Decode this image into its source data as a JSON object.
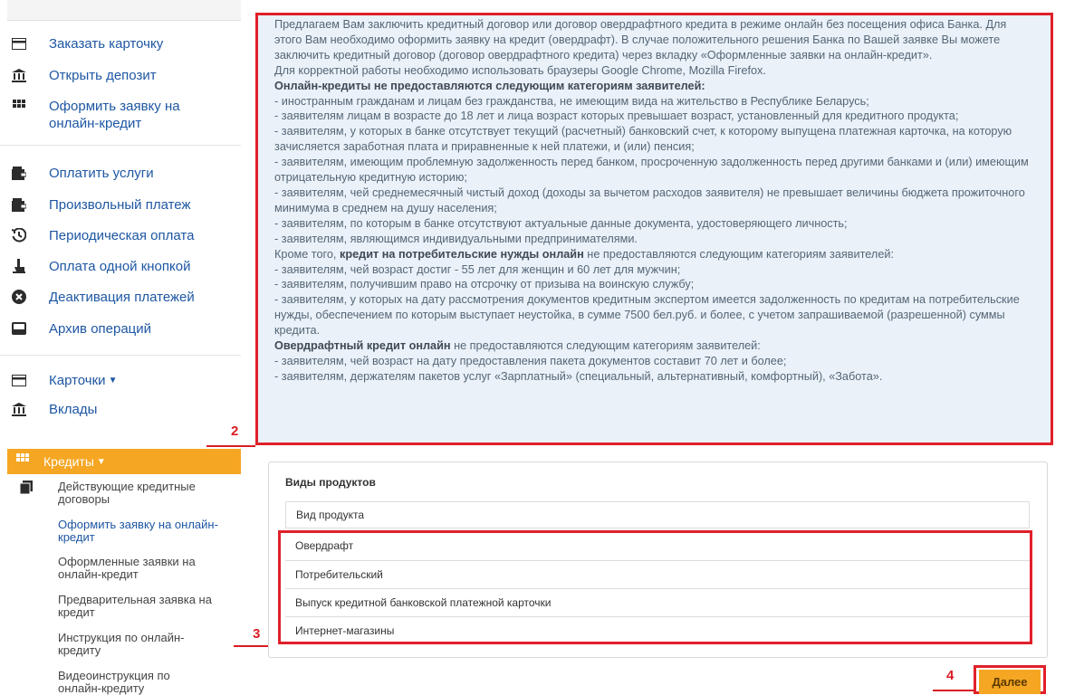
{
  "sidebar": {
    "items_top": [
      {
        "label": "Заказать карточку",
        "icon": "card-icon"
      },
      {
        "label": "Открыть депозит",
        "icon": "bank-icon"
      },
      {
        "label": "Оформить заявку на онлайн-кредит",
        "icon": "grid-icon"
      }
    ],
    "items_pay": [
      {
        "label": "Оплатить услуги",
        "icon": "wallet-icon"
      },
      {
        "label": "Произвольный платеж",
        "icon": "wallet-icon"
      },
      {
        "label": "Периодическая оплата",
        "icon": "history-icon"
      },
      {
        "label": "Оплата одной кнопкой",
        "icon": "hand-tap-icon"
      },
      {
        "label": "Деактивация платежей",
        "icon": "close-circle-icon"
      },
      {
        "label": "Архив операций",
        "icon": "archive-icon"
      }
    ],
    "items_acc": [
      {
        "label": "Карточки",
        "icon": "card-icon"
      },
      {
        "label": "Вклады",
        "icon": "bank-icon"
      }
    ],
    "credits_label": "Кредиты",
    "credits_sub": [
      {
        "label": "Действующие кредитные договоры"
      },
      {
        "label": "Оформить заявку на онлайн-кредит"
      },
      {
        "label": "Оформленные заявки на онлайн-кредит"
      },
      {
        "label": "Предварительная заявка на кредит"
      },
      {
        "label": "Инструкция по онлайн-кредиту"
      },
      {
        "label": "Видеоинструкция по онлайн-кредиту"
      }
    ]
  },
  "info": {
    "p1": "Предлагаем Вам заключить кредитный договор или договор овердрафтного кредита в режиме онлайн без посещения офиса Банка. Для этого Вам необходимо оформить заявку на кредит (овердрафт). В случае положительного решения Банка по Вашей заявке Вы можете заключить кредитный договор (договор овердрафтного кредита) через вкладку «Оформленные заявки на онлайн-кредит».",
    "p2": "Для корректной работы необходимо использовать браузеры Google Chrome, Mozilla Firefox.",
    "h1": "Онлайн-кредиты не предоставляются следующим категориям заявителей:",
    "list1": [
      "- иностранным гражданам и лицам без гражданства, не имеющим вида на жительство в Республике Беларусь;",
      "- заявителям лицам в возрасте до 18 лет и лица возраст которых превышает возраст, установленный для кредитного продукта;",
      "- заявителям, у которых в банке отсутствует текущий (расчетный) банковский счет, к которому выпущена платежная карточка, на которую зачисляется заработная плата и приравненные к ней платежи, и (или) пенсия;",
      "- заявителям, имеющим проблемную задолженность перед банком, просроченную задолженность перед другими банками и (или) имеющим отрицательную кредитную историю;",
      "- заявителям, чей среднемесячный чистый доход (доходы за вычетом расходов заявителя) не превышает величины бюджета прожиточного минимума в среднем на душу населения;",
      "- заявителям, по которым в банке отсутствуют актуальные данные документа, удостоверяющего личность;",
      "- заявителям, являющимся индивидуальными предпринимателями."
    ],
    "p3_pre": "Кроме того, ",
    "p3_bold": "кредит на потребительские нужды онлайн",
    "p3_post": " не предоставляются следующим категориям заявителей:",
    "list2": [
      "- заявителям, чей возраст достиг - 55 лет для женщин и 60 лет для мужчин;",
      "- заявителям, получившим право на отсрочку от призыва на воинскую службу;",
      "- заявителям, у которых на дату рассмотрения документов кредитным экспертом имеется задолженность по кредитам на потребительские нужды, обеспечением по которым выступает неустойка, в сумме 7500 бел.руб. и более, с учетом запрашиваемой (разрешенной) суммы кредита."
    ],
    "p4_bold": "Овердрафтный кредит онлайн",
    "p4_post": " не предоставляются следующим категориям заявителей:",
    "list3": [
      "- заявителям, чей возраст на дату предоставления пакета документов составит 70 лет и более;",
      "- заявителям, держателям пакетов услуг «Зарплатный» (специальный, альтернативный, комфортный), «Забота»."
    ]
  },
  "products": {
    "title": "Виды продуктов",
    "header": "Вид продукта",
    "rows": [
      "Овердрафт",
      "Потребительский",
      "Выпуск кредитной банковской платежной карточки",
      "Интернет-магазины"
    ]
  },
  "markers": {
    "m2": "2",
    "m3": "3",
    "m4": "4"
  },
  "next_button": "Далее",
  "colors": {
    "accent": "#f5a623",
    "annotation": "#e0202a",
    "link": "#1e57a3",
    "info_bg": "#eaf1f8"
  }
}
